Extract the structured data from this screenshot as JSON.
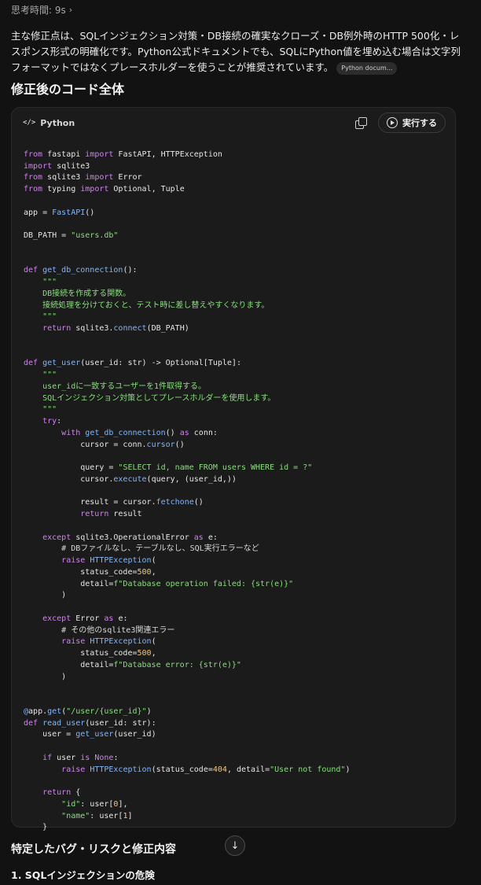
{
  "thinking": {
    "label": "思考時間: 9s"
  },
  "summary": {
    "text": "主な修正点は、SQLインジェクション対策・DB接続の確実なクローズ・DB例外時のHTTP 500化・レスポンス形式の明確化です。Python公式ドキュメントでも、SQLにPython値を埋め込む場合は文字列フォーマットではなくプレースホルダーを使うことが推奨されています。",
    "chip": "Python docum..."
  },
  "section": {
    "title": "修正後のコード全体"
  },
  "code_block": {
    "language": "Python",
    "lang_icon": "</>",
    "run_label": "実行する",
    "lines": [
      "from fastapi import FastAPI, HTTPException",
      "import sqlite3",
      "from sqlite3 import Error",
      "from typing import Optional, Tuple",
      "",
      "app = FastAPI()",
      "",
      "DB_PATH = \"users.db\"",
      "",
      "",
      "def get_db_connection():",
      "    \"\"\"",
      "    DB接続を作成する関数。",
      "    接続処理を分けておくと、テスト時に差し替えやすくなります。",
      "    \"\"\"",
      "    return sqlite3.connect(DB_PATH)",
      "",
      "",
      "def get_user(user_id: str) -> Optional[Tuple]:",
      "    \"\"\"",
      "    user_idに一致するユーザーを1件取得する。",
      "    SQLインジェクション対策としてプレースホルダーを使用します。",
      "    \"\"\"",
      "    try:",
      "        with get_db_connection() as conn:",
      "            cursor = conn.cursor()",
      "",
      "            query = \"SELECT id, name FROM users WHERE id = ?\"",
      "            cursor.execute(query, (user_id,))",
      "",
      "            result = cursor.fetchone()",
      "            return result",
      "",
      "    except sqlite3.OperationalError as e:",
      "        # DBファイルなし、テーブルなし、SQL実行エラーなど",
      "        raise HTTPException(",
      "            status_code=500,",
      "            detail=f\"Database operation failed: {str(e)}\"",
      "        )",
      "",
      "    except Error as e:",
      "        # その他のsqlite3関連エラー",
      "        raise HTTPException(",
      "            status_code=500,",
      "            detail=f\"Database error: {str(e)}\"",
      "        )",
      "",
      "",
      "@app.get(\"/user/{user_id}\")",
      "def read_user(user_id: str):",
      "    user = get_user(user_id)",
      "",
      "    if user is None:",
      "        raise HTTPException(status_code=404, detail=\"User not found\")",
      "",
      "    return {",
      "        \"id\": user[0],",
      "        \"name\": user[1]",
      "    }"
    ]
  },
  "next_section": {
    "title": "特定したバグ・リスクと修正内容"
  },
  "next_subsection": {
    "title": "1. SQLインジェクションの危険"
  },
  "colors": {
    "background": "#121212",
    "card": "#1b1b1b",
    "keyword": "#d081f0",
    "function": "#7fb6ff",
    "string": "#86df7a"
  }
}
